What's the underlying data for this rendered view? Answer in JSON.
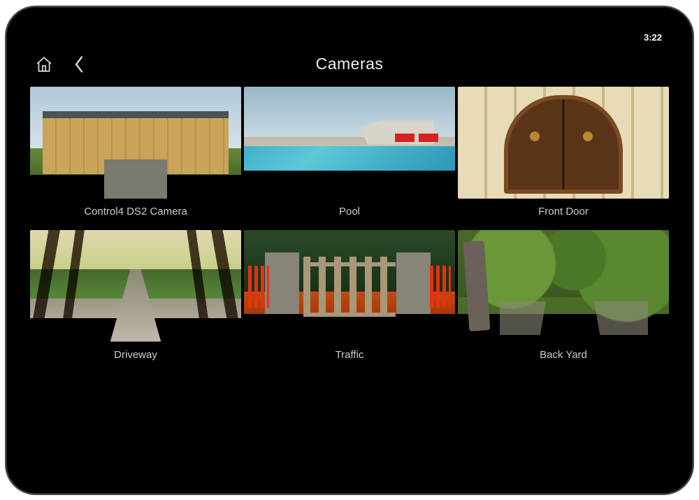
{
  "statusbar": {
    "time": "3:22"
  },
  "header": {
    "title": "Cameras"
  },
  "cameras": [
    {
      "label": "Control4 DS2 Camera",
      "thumb": "thumb-chateau"
    },
    {
      "label": "Pool",
      "thumb": "thumb-pool"
    },
    {
      "label": "Front Door",
      "thumb": "thumb-door"
    },
    {
      "label": "Driveway",
      "thumb": "thumb-driveway"
    },
    {
      "label": "Traffic",
      "thumb": "thumb-gate"
    },
    {
      "label": "Back Yard",
      "thumb": "thumb-yard"
    }
  ]
}
